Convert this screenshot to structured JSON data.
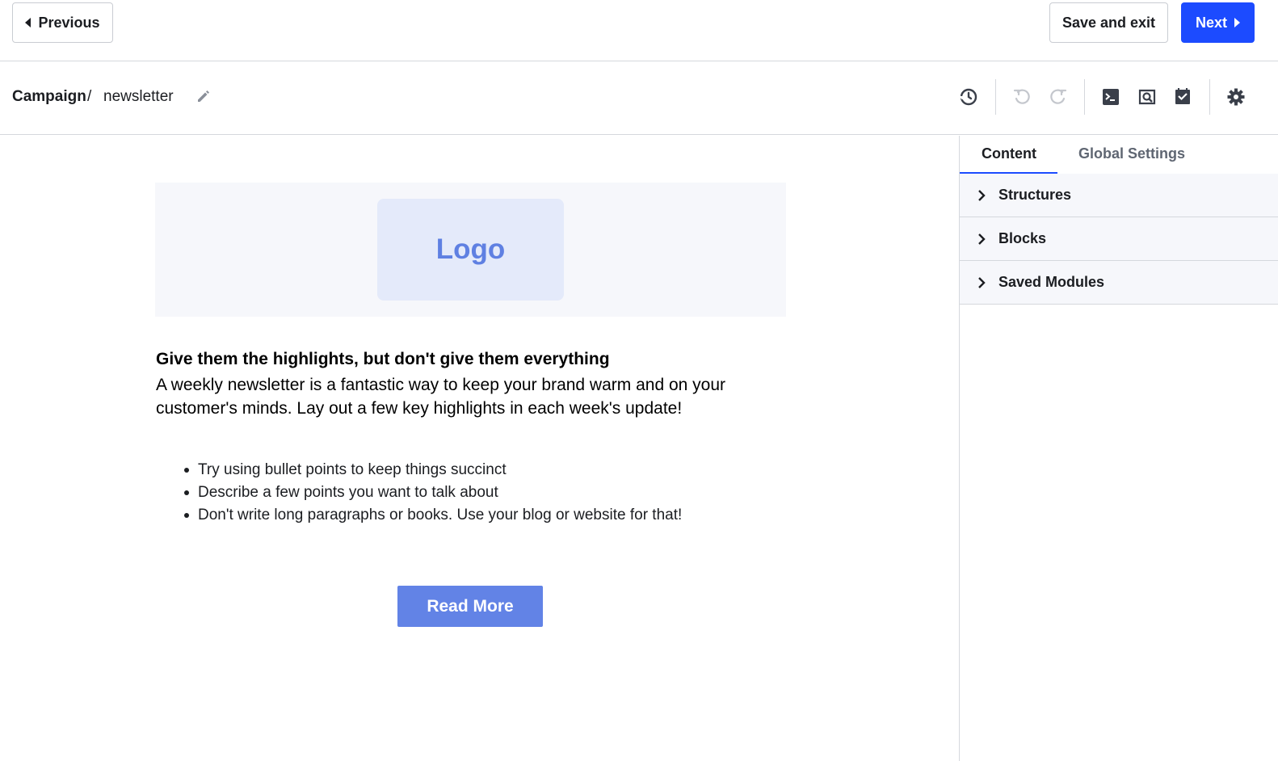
{
  "topbar": {
    "previous_label": "Previous",
    "save_exit_label": "Save and exit",
    "next_label": "Next"
  },
  "breadcrumb": {
    "root": "Campaign",
    "separator": "/",
    "name": "newsletter"
  },
  "toolbar": {
    "icons": [
      "history-icon",
      "undo-icon",
      "redo-icon",
      "code-icon",
      "preview-icon",
      "test-check-icon",
      "settings-gear-icon"
    ]
  },
  "email": {
    "logo_text": "Logo",
    "headline": "Give them the highlights, but don't give them everything",
    "intro": "A weekly newsletter is a fantastic way to keep your brand warm and on your customer's minds. Lay out a few key highlights in each week's update!",
    "bullets": [
      "Try using bullet points to keep things succinct",
      "Describe a few points you want to talk about",
      "Don't write long paragraphs or books. Use your blog or website for that!"
    ],
    "cta_label": "Read More"
  },
  "panel": {
    "tabs": [
      "Content",
      "Global Settings"
    ],
    "active_tab": "Content",
    "sections": [
      "Structures",
      "Blocks",
      "Saved Modules"
    ]
  },
  "colors": {
    "primary": "#1c4bff",
    "cta": "#6283e6",
    "logo_bg": "#e4eafa",
    "logo_text": "#5f80e2"
  }
}
